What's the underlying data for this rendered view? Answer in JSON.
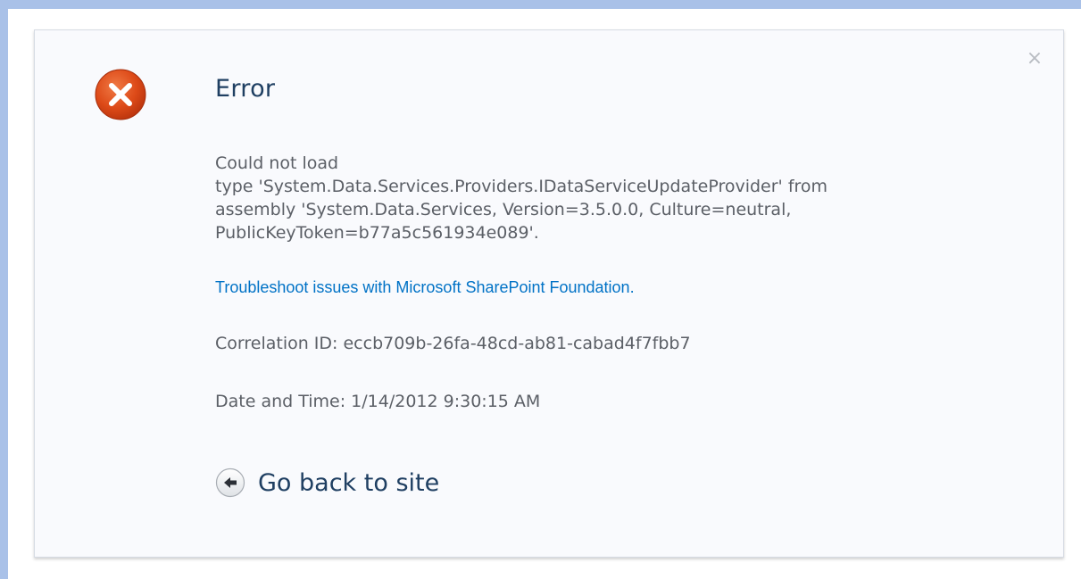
{
  "dialog": {
    "title": "Error",
    "close_glyph": "×",
    "message_lines": [
      "Could not load",
      "type 'System.Data.Services.Providers.IDataServiceUpdateProvider' from",
      "assembly 'System.Data.Services, Version=3.5.0.0, Culture=neutral,",
      "PublicKeyToken=b77a5c561934e089'."
    ],
    "troubleshoot_link": "Troubleshoot issues with Microsoft SharePoint Foundation.",
    "correlation_id": "Correlation ID: eccb709b-26fa-48cd-ab81-cabad4f7fbb7",
    "date_time": "Date and Time: 1/14/2012 9:30:15 AM",
    "go_back_label": "Go back to site"
  },
  "icons": {
    "error": "error-x-circle-icon",
    "back": "back-arrow-circle-icon",
    "close": "close-icon"
  },
  "colors": {
    "error_red": "#d9471d",
    "title_text": "#1f3f62",
    "body_text": "#5b5f66",
    "link": "#0072c6",
    "frame_band": "#a9c1e8",
    "dialog_bg": "#f9fafd"
  }
}
